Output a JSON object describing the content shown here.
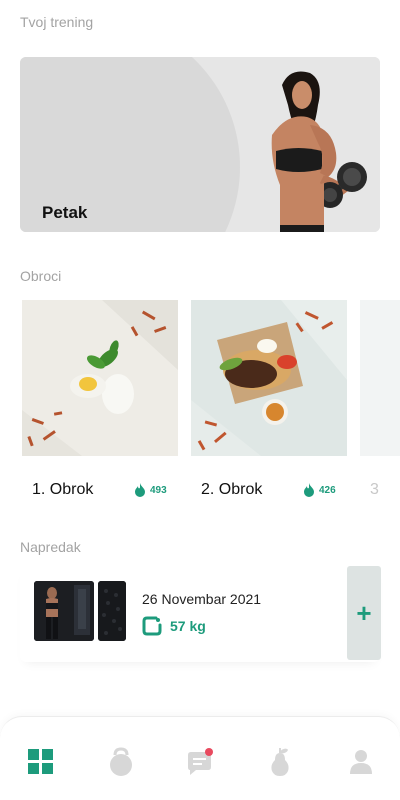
{
  "training": {
    "section_title": "Tvoj trening",
    "day": "Petak"
  },
  "meals": {
    "section_title": "Obroci",
    "items": [
      {
        "name": "1. Obrok",
        "kcal": "493"
      },
      {
        "name": "2. Obrok",
        "kcal": "426"
      }
    ],
    "peek_label": "3"
  },
  "progress": {
    "section_title": "Napredak",
    "date": "26 Novembar 2021",
    "weight": "57 kg",
    "add_label": "+"
  },
  "nav": {
    "items": [
      "dashboard-icon",
      "kettlebell-icon",
      "chat-icon",
      "pear-icon",
      "profile-icon"
    ],
    "active_index": 0,
    "chat_has_notification": true
  },
  "colors": {
    "accent": "#1d9b7c",
    "notification": "#e84a5f",
    "inactive_icon": "#d7d7d7"
  }
}
